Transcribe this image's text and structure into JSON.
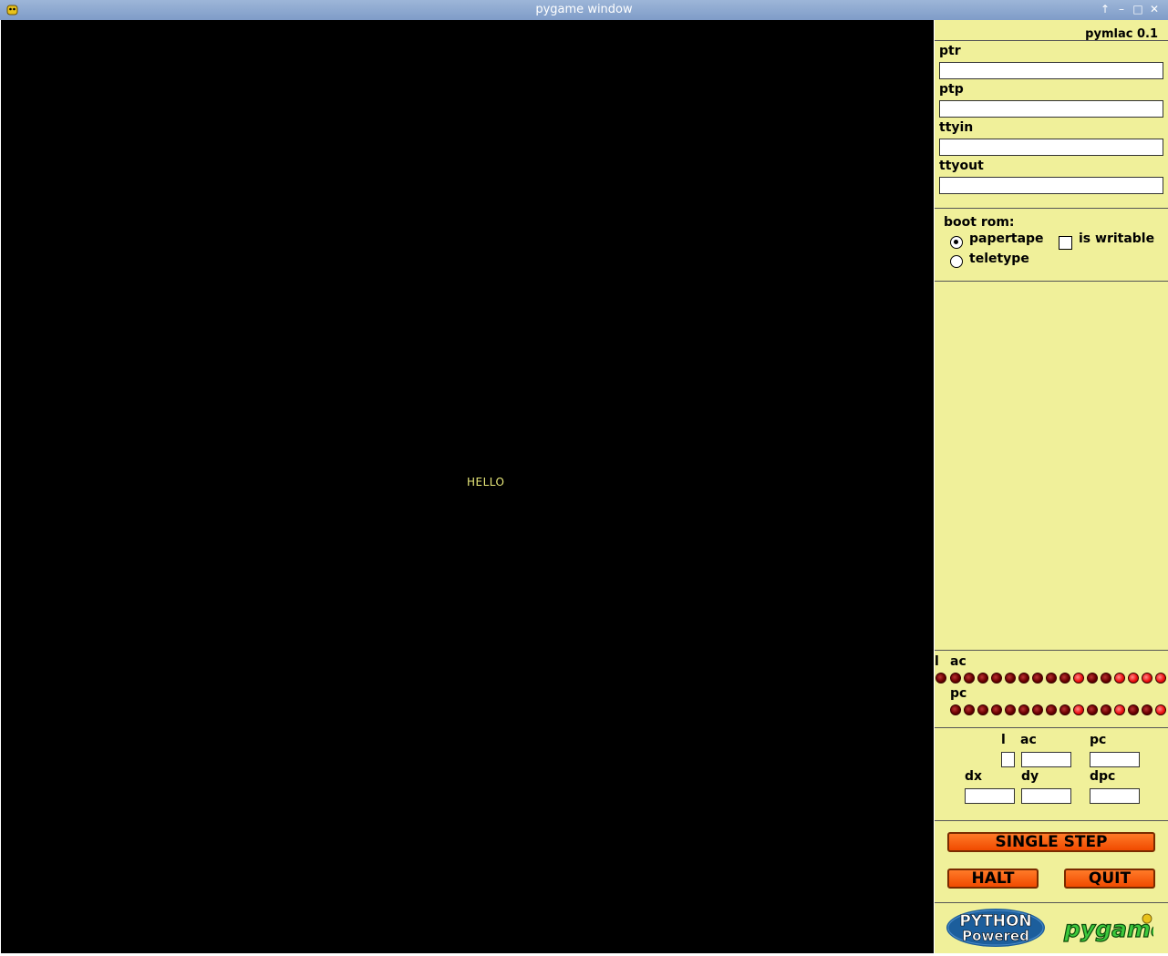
{
  "window": {
    "title": "pygame window"
  },
  "screen": {
    "text": "HELLO"
  },
  "panel": {
    "version": "pymlac 0.1",
    "devices": [
      {
        "label": "ptr",
        "value": ""
      },
      {
        "label": "ptp",
        "value": ""
      },
      {
        "label": "ttyin",
        "value": ""
      },
      {
        "label": "ttyout",
        "value": ""
      }
    ],
    "boot_rom": {
      "label": "boot rom:",
      "options": [
        {
          "label": "papertape",
          "selected": true
        },
        {
          "label": "teletype",
          "selected": false
        }
      ],
      "writable_label": "is writable",
      "writable_checked": false
    },
    "lights": {
      "l_label": "l",
      "ac_label": "ac",
      "pc_label": "pc",
      "l_bit": 0,
      "ac_bits": [
        0,
        0,
        0,
        0,
        0,
        0,
        0,
        0,
        0,
        1,
        0,
        0,
        1,
        1,
        1,
        1
      ],
      "pc_bits": [
        0,
        0,
        0,
        0,
        0,
        0,
        0,
        0,
        0,
        1,
        0,
        0,
        1,
        0,
        0,
        1
      ]
    },
    "registers": {
      "l_label": "l",
      "ac_label": "ac",
      "pc_label": "pc",
      "dx_label": "dx",
      "dy_label": "dy",
      "dpc_label": "dpc",
      "l": "",
      "ac": "",
      "pc": "",
      "dx": "",
      "dy": "",
      "dpc": ""
    },
    "buttons": {
      "single_step": "SINGLE STEP",
      "halt": "HALT",
      "quit": "QUIT"
    },
    "logos": {
      "python_line1": "PYTHON",
      "python_line2": "Powered",
      "pygame": "pygame"
    }
  },
  "colors": {
    "panel_bg": "#f0f09a",
    "button": "#f05a0a",
    "led_on": "#ee1010",
    "led_off": "#6a0000",
    "screen_text": "#e8e87a"
  }
}
